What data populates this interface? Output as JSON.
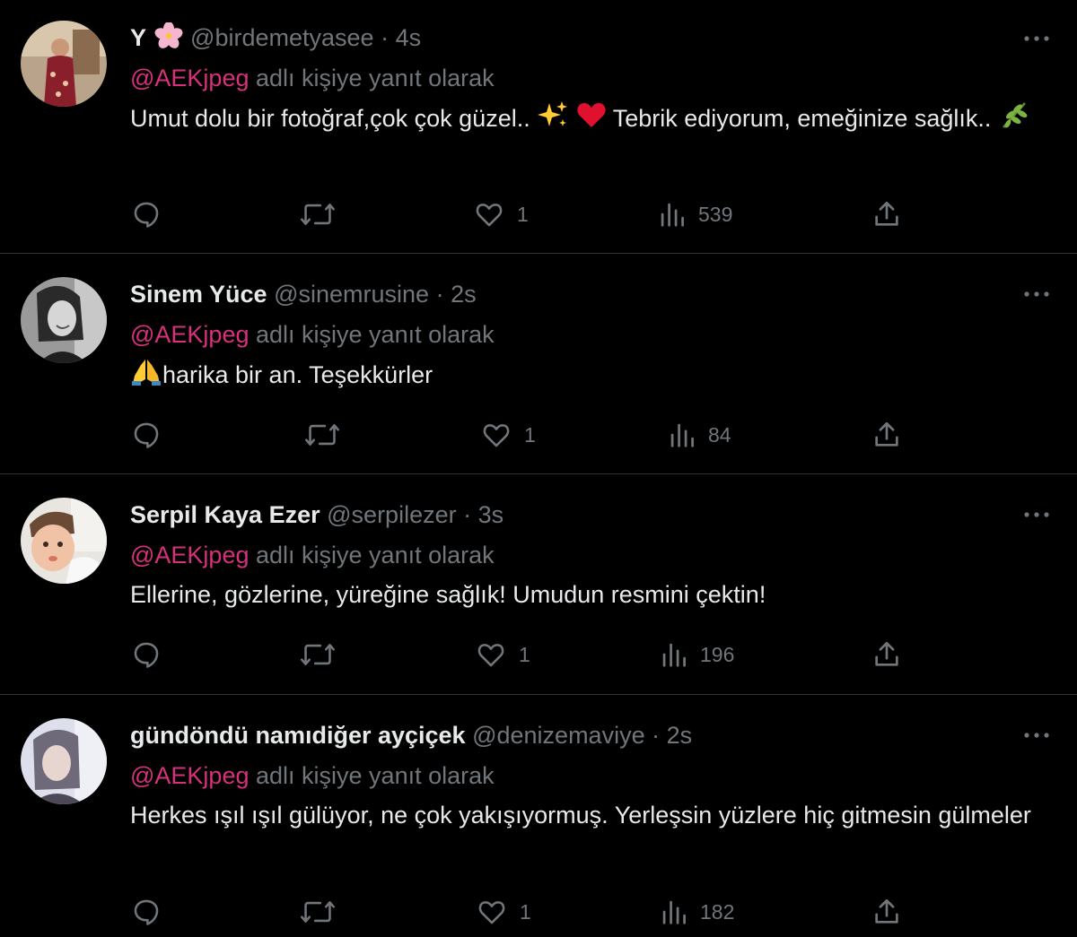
{
  "replies": [
    {
      "display_name": "Y",
      "name_emoji": "cherry-blossom",
      "handle": "@birdemetyasee",
      "separator": "·",
      "time": "4s",
      "reply_to": "@AEKjpeg",
      "reply_suffix": "adlı kişiye yanıt olarak",
      "text_parts": [
        "Umut dolu bir fotoğraf,çok çok güzel.. ",
        " ",
        " Tebrik ediyorum, emeğinize sağlık.. "
      ],
      "text_emojis": [
        "sparkles",
        "red-heart",
        "herb"
      ],
      "like_count": "1",
      "view_count": "539"
    },
    {
      "display_name": "Sinem Yüce",
      "handle": "@sinemrusine",
      "separator": "·",
      "time": "2s",
      "reply_to": "@AEKjpeg",
      "reply_suffix": "adlı kişiye yanıt olarak",
      "text_parts": [
        "harika  bir an. Teşekkürler"
      ],
      "text_emojis": [
        "folded-hands"
      ],
      "like_count": "1",
      "view_count": "84"
    },
    {
      "display_name": "Serpil Kaya Ezer",
      "handle": "@serpilezer",
      "separator": "·",
      "time": "3s",
      "reply_to": "@AEKjpeg",
      "reply_suffix": "adlı kişiye yanıt olarak",
      "text_parts": [
        "Ellerine, gözlerine, yüreğine sağlık!  Umudun resmini çektin!"
      ],
      "like_count": "1",
      "view_count": "196"
    },
    {
      "display_name": "gündöndü namıdiğer ayçiçek",
      "handle": "@denizemaviye",
      "separator": "·",
      "time": "2s",
      "reply_to": "@AEKjpeg",
      "reply_suffix": "adlı kişiye yanıt olarak",
      "text_parts": [
        "Herkes ışıl ışıl gülüyor, ne çok yakışıyormuş. Yerleşsin yüzlere hiç gitmesin gülmeler"
      ],
      "like_count": "1",
      "view_count": "182"
    }
  ],
  "icons": {
    "reply": "reply-icon",
    "retweet": "retweet-icon",
    "like": "like-icon",
    "views": "views-icon",
    "share": "share-icon",
    "more": "more-icon"
  },
  "colors": {
    "background": "#000000",
    "text": "#e7e9ea",
    "muted": "#71767b",
    "mention": "#d6317a",
    "divider": "#2f3336"
  }
}
